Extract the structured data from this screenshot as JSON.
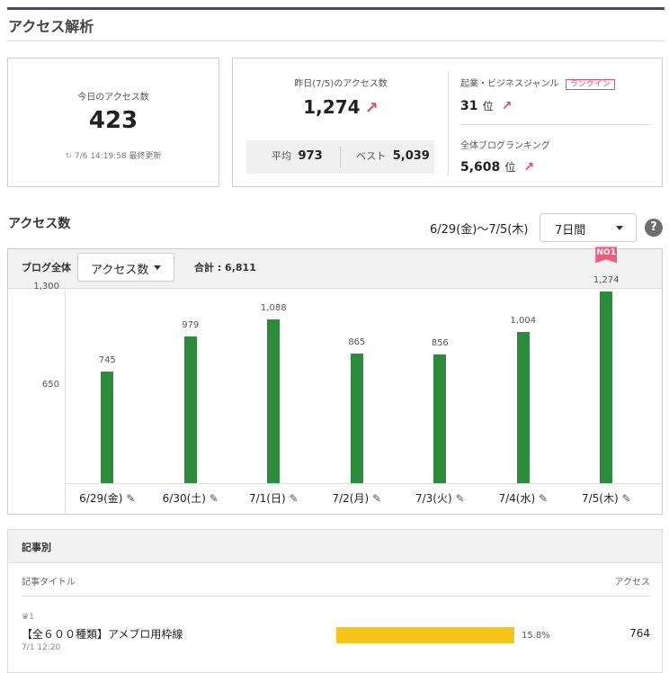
{
  "page": {
    "title": "アクセス解析"
  },
  "today": {
    "label": "今日のアクセス数",
    "count": "423",
    "updated": "7/6 14:19:58 最終更新"
  },
  "yesterday": {
    "label": "昨日(7/5)のアクセス数",
    "count": "1,274",
    "avg_label": "平均",
    "avg": "973",
    "best_label": "ベスト",
    "best": "5,039"
  },
  "ranking": {
    "genre_label": "起業・ビジネスジャンル",
    "badge": "ランクイン",
    "genre_rank": "31",
    "unit": "位",
    "overall_label": "全体ブログランキング",
    "overall_rank": "5,608"
  },
  "access": {
    "title": "アクセス数",
    "date_range": "6/29(金)～7/5(木)",
    "period": "7日間",
    "scope": "ブログ全体",
    "metric": "アクセス数",
    "total": "合計 : 6,811",
    "help": "?"
  },
  "chart_data": {
    "type": "bar",
    "categories": [
      "6/29(金)",
      "6/30(土)",
      "7/1(日)",
      "7/2(月)",
      "7/3(火)",
      "7/4(水)",
      "7/5(木)"
    ],
    "values": [
      745,
      979,
      1088,
      865,
      856,
      1004,
      1274
    ],
    "value_labels": [
      "745",
      "979",
      "1,088",
      "865",
      "856",
      "1,004",
      "1,274"
    ],
    "yticks": [
      "1,300",
      "650"
    ],
    "ylim": [
      0,
      1650
    ],
    "badge_on_max": "NO1",
    "color": "#2d8c3c"
  },
  "articles": {
    "section_title": "記事別",
    "col_title": "記事タイトル",
    "col_access": "アクセス",
    "items": [
      {
        "rank": "1",
        "title": "【全６００種類】アメブロ用枠線",
        "date": "7/1 12:20",
        "percent": "15.8%",
        "share": 0.158,
        "count": "764"
      }
    ]
  },
  "colors": {
    "accent": "#e8466e",
    "bar": "#2d8c3c",
    "share_bar": "#f5c518"
  },
  "icons": {
    "refresh": "refresh-icon",
    "up": "up-arrow-icon",
    "edit": "pencil-icon",
    "crown": "crown-icon"
  }
}
